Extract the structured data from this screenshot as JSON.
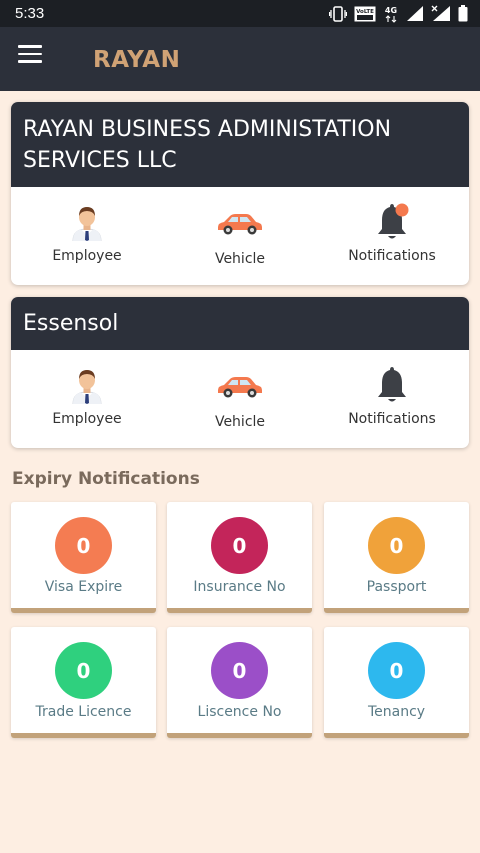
{
  "status_bar": {
    "time": "5:33",
    "icons": [
      "vibrate-icon",
      "volte-icon",
      "4g-icon",
      "signal-icon",
      "signal-x-icon",
      "battery-icon"
    ],
    "volte_text": "VoLTE",
    "network_text": "4G"
  },
  "app_bar": {
    "title": "RAYAN",
    "menu_icon": "hamburger-menu-icon",
    "title_color": "#d0a275",
    "background": "#2c303a"
  },
  "companies": [
    {
      "name_lines": [
        "RAYAN BUSINESS ADMINISTATION",
        "SERVICES LLC"
      ],
      "actions": [
        {
          "label": "Employee",
          "icon": "employee-icon"
        },
        {
          "label": "Vehicle",
          "icon": "car-icon"
        },
        {
          "label": "Notifications",
          "icon": "bell-icon",
          "has_badge": true
        }
      ]
    },
    {
      "name_lines": [
        "Essensol"
      ],
      "actions": [
        {
          "label": "Employee",
          "icon": "employee-icon"
        },
        {
          "label": "Vehicle",
          "icon": "car-icon"
        },
        {
          "label": "Notifications",
          "icon": "bell-icon",
          "has_badge": false
        }
      ]
    }
  ],
  "expiry": {
    "title": "Expiry Notifications",
    "items": [
      {
        "label": "Visa Expire",
        "count": "0",
        "color": "#f47c52"
      },
      {
        "label": "Insurance No",
        "count": "0",
        "color": "#c3255a"
      },
      {
        "label": "Passport",
        "count": "0",
        "color": "#f0a23a"
      },
      {
        "label": "Trade Licence",
        "count": "0",
        "color": "#2fd07e"
      },
      {
        "label": "Liscence No",
        "count": "0",
        "color": "#9b4fc8"
      },
      {
        "label": "Tenancy",
        "count": "0",
        "color": "#2db8ee"
      }
    ]
  }
}
